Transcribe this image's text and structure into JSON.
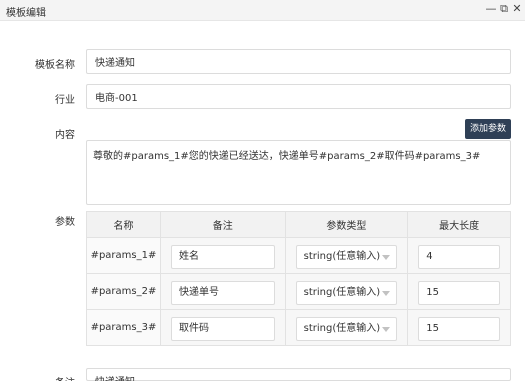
{
  "window": {
    "title": "模板编辑",
    "min_icon": "minimize-icon",
    "max_icon": "maximize-icon",
    "close_icon": "close-icon"
  },
  "form": {
    "template_name": {
      "label": "模板名称",
      "value": "快递通知"
    },
    "industry": {
      "label": "行业",
      "value": "电商-001"
    },
    "content": {
      "label": "内容",
      "value": "尊敬的#params_1#您的快递已经送达，快递单号#params_2#取件码#params_3#",
      "add_param_label": "添加参数"
    },
    "params": {
      "label": "参数",
      "headers": [
        "名称",
        "备注",
        "参数类型",
        "最大长度"
      ],
      "rows": [
        {
          "name": "#params_1#",
          "remark": "姓名",
          "type": "string(任意输入)",
          "max_length": "4"
        },
        {
          "name": "#params_2#",
          "remark": "快递单号",
          "type": "string(任意输入)",
          "max_length": "15"
        },
        {
          "name": "#params_3#",
          "remark": "取件码",
          "type": "string(任意输入)",
          "max_length": "15"
        }
      ]
    },
    "remark": {
      "label": "备注",
      "value": "快递通知"
    }
  },
  "colors": {
    "add_button_bg": "#2f4056",
    "titlebar_bg": "#f4f4f4"
  }
}
